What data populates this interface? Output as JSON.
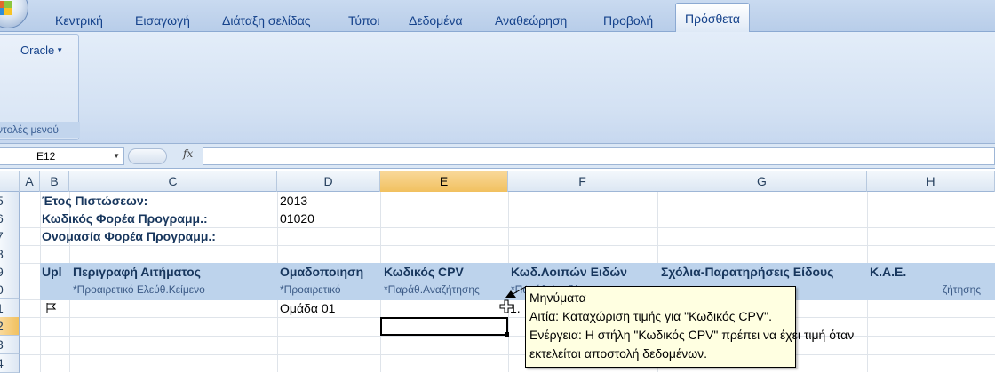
{
  "ribbon": {
    "tabs": [
      "Κεντρική",
      "Εισαγωγή",
      "Διάταξη σελίδας",
      "Τύποι",
      "Δεδομένα",
      "Αναθεώρηση",
      "Προβολή",
      "Πρόσθετα"
    ],
    "active_tab": "Πρόσθετα",
    "oracle_label": "Oracle",
    "group_label": "ντολές μενού"
  },
  "formula_bar": {
    "cell_ref": "E12",
    "fx_label": "fx",
    "formula": ""
  },
  "grid": {
    "columns": [
      "A",
      "B",
      "C",
      "D",
      "E",
      "F",
      "G",
      "H"
    ],
    "selected_column": "E",
    "rows": [
      "5",
      "6",
      "7",
      "8",
      "9",
      "0",
      "1",
      "2",
      "3",
      "4"
    ],
    "selected_row": "2",
    "info": {
      "year_label": "Έτος Πιστώσεων:",
      "year_value": "2013",
      "code_label": "Κωδικός Φορέα Προγραμμ.:",
      "code_value": "01020",
      "name_label": "Ονομασία Φορέα Προγραμμ.:"
    },
    "table_headers": {
      "upl": "Upl",
      "description": "Περιγραφή Αιτήματος",
      "grouping": "Ομαδοποιηση",
      "cpv": "Κωδικός CPV",
      "other_codes": "Κωδ.Λοιπών Ειδών",
      "comments": "Σχόλια-Παρατηρήσεις Είδους",
      "kae": "Κ.Α.Ε."
    },
    "table_subheaders": {
      "description": "*Προαιρετικό Ελεύθ.Κείμενο",
      "grouping": "*Προαιρετικό",
      "cpv": "*Παράθ.Αναζήτησης",
      "other_codes": "*Παράθ.Αναζήτησης",
      "h": "ζήτησης"
    },
    "row1": {
      "grouping": "Ομάδα 01",
      "e_partial": "1."
    }
  },
  "tooltip": {
    "title": "Μηνύματα",
    "line1": "Αιτία: Καταχώριση τιμής για \"Κωδικός CPV\".",
    "line2": "Ενέργεια: Η στήλη \"Κωδικός CPV\" πρέπει να έχει τιμή όταν",
    "line3": "εκτελείται αποστολή δεδομένων."
  }
}
